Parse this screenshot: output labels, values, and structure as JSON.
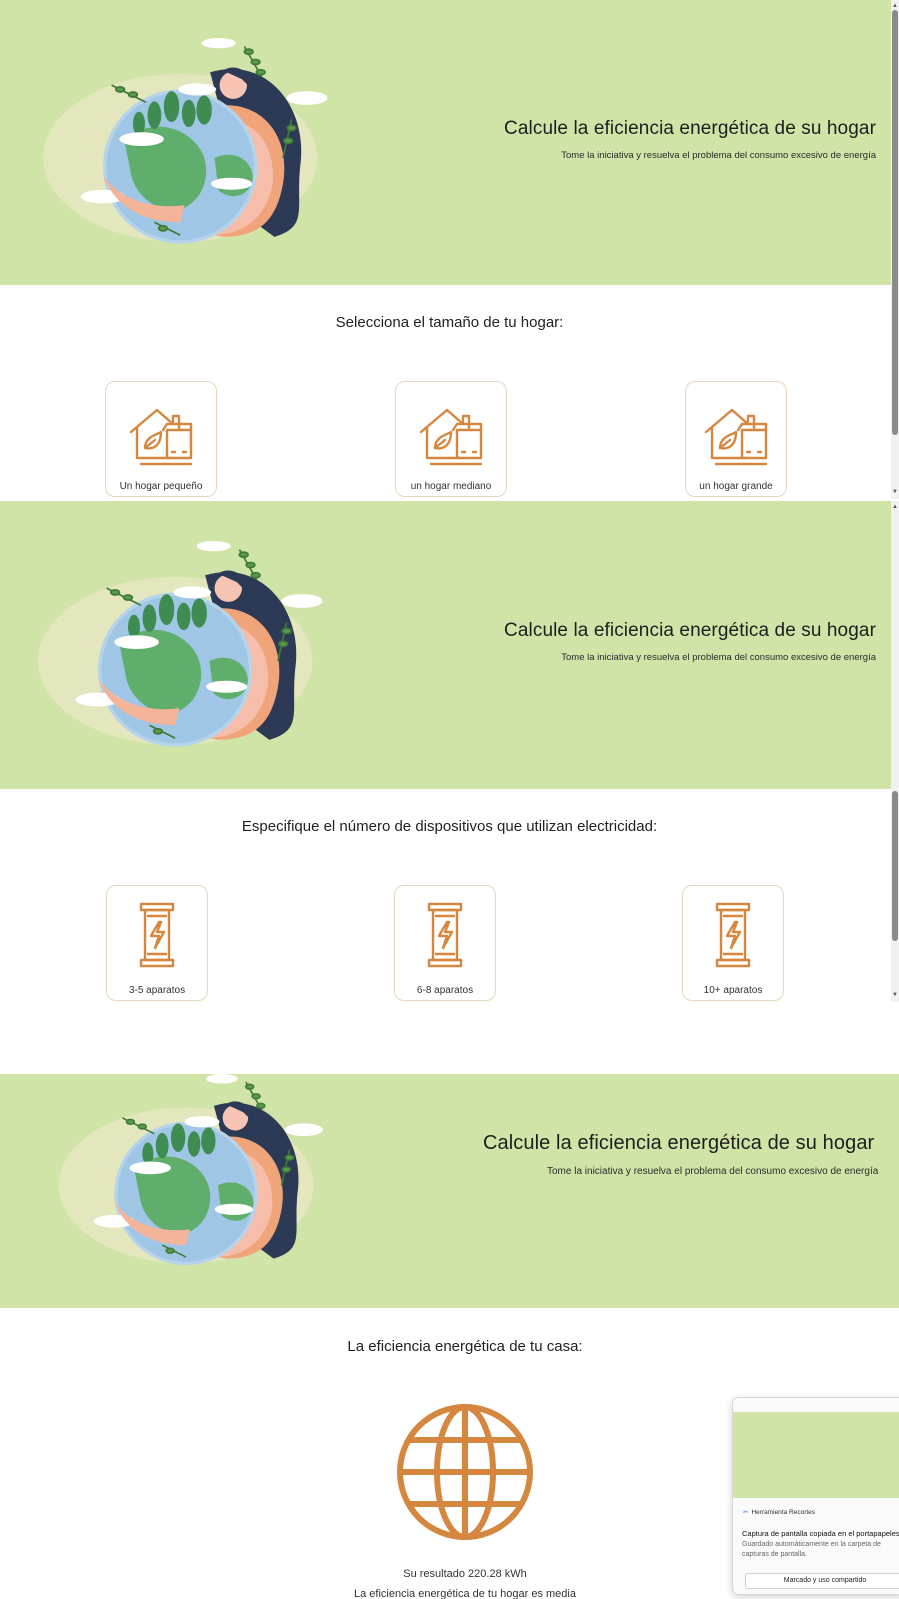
{
  "colors": {
    "hero_bg": "#d0e4a7",
    "icon_orange": "#d5873f",
    "card_border": "#e6d6bf"
  },
  "hero": {
    "title": "Calcule la eficiencia energética de su hogar",
    "subtitle": "Tome la iniciativa y resuelva el problema del consumo excesivo de energía",
    "illustration_icon": "woman-hugging-earth-illustration"
  },
  "step1": {
    "heading": "Selecciona el tamaño de tu hogar:",
    "options": [
      {
        "label": "Un hogar pequeño",
        "icon": "eco-house-icon"
      },
      {
        "label": "un hogar mediano",
        "icon": "eco-house-icon"
      },
      {
        "label": "un hogar grande",
        "icon": "eco-house-icon"
      }
    ]
  },
  "step2": {
    "heading": "Especifique el número de dispositivos que utilizan electricidad:",
    "options": [
      {
        "label": "3-5 aparatos",
        "icon": "battery-bolt-icon"
      },
      {
        "label": "6-8 aparatos",
        "icon": "battery-bolt-icon"
      },
      {
        "label": "10+ aparatos",
        "icon": "battery-bolt-icon"
      }
    ]
  },
  "step3": {
    "heading": "La eficiencia energética de tu casa:",
    "icon": "globe-icon",
    "result": "Su resultado 220.28 kWh",
    "rating": "La eficiencia energética de tu hogar es media"
  },
  "notification": {
    "app_name": "Herramienta Recortes",
    "title": "Captura de pantalla copiada en el portapapeles",
    "body": "Guardado automáticamente en la carpeta de capturas de pantalla.",
    "button": "Marcado y uso compartido"
  }
}
